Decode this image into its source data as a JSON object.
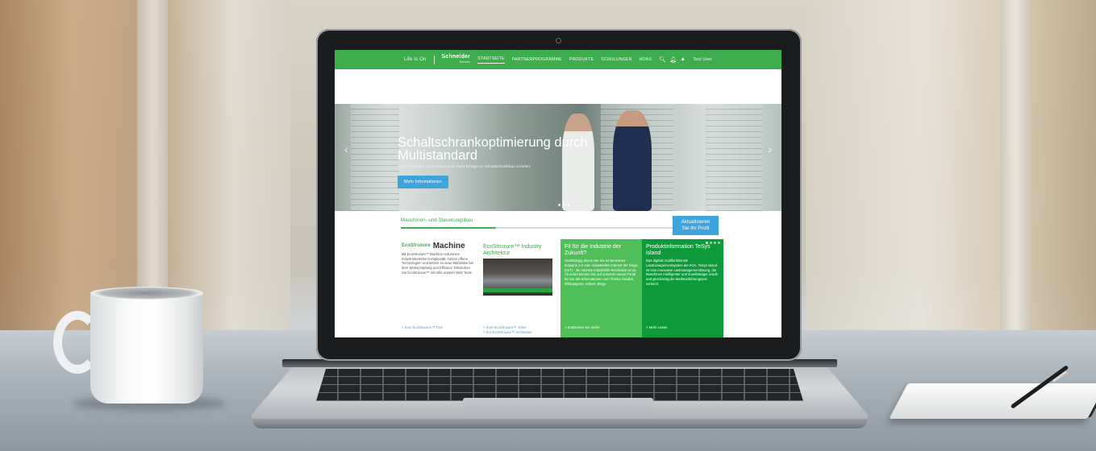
{
  "topbar": {
    "brand": "Life Is On",
    "logo_main": "Schneider",
    "logo_sub": "Electric",
    "nav": [
      "STARTSEITE",
      "PARTNERPROGRAMME",
      "PRODUKTE",
      "SCHULUNGEN",
      "HOAS"
    ],
    "active_nav_index": 0,
    "icons": [
      "search-icon",
      "bell-icon",
      "user-icon"
    ],
    "user": "Test User"
  },
  "hero": {
    "title": "Schaltschrankoptimierung durch Multistandard",
    "subtitle": "Durch Produkte mit Multistandard mehr Erfolge im Schaltschrankbau erzielen.",
    "button": "Mehr Informationen",
    "prev": "‹",
    "next": "›"
  },
  "section": {
    "tab": "Maschinen- und Steuerungsbau",
    "profile_button_line1": "Aktualisieren",
    "profile_button_line2": "Sie Ihr Profil"
  },
  "cards": [
    {
      "logo": "EcoStruxure",
      "title": "Machine",
      "body": "Mit EcoStruxure™ Machine reduzieren Industriebetriebe Komplexität, nutzen offene Technologien und setzen so neue Maßstäbe bei ihrer Wertschöpfung und Effizienz. Entdecken Sie EcoStruxure™ mit Hilfe unserer Web Tools.",
      "link": "> Zum EcoStruxure™ Tool"
    },
    {
      "title": "EcoStruxure™ Industry Architektur",
      "link1": "> Zum EcoStruxure™ Video",
      "link2": "> Zur EcoStruxure™ Architektur"
    },
    {
      "title": "Fit für die Industrie der Zukunft?",
      "body": "Unabhängig davon wie Sie es benennen - Industrie 4.0 oder Industrielles Internet der Dinge (IIoT) - die nächste industrielle Revolution ist da. Ab sofort können Sie auf unserem neuen Portal für Sie alle Informationen zum Thema Studien, Whitepapers, Videos, Blogs.",
      "link": "> Entdecken Sie mehr!"
    },
    {
      "title": "Produktinformation TeSys island",
      "body": "Das digitale multifunktionale Lastmanagementsystem der IIOA. TeSys island ist eine innovative Lastmanagementlösung, die Maschinen intelligenter und zuverlässiger macht und gleichzeitig die Markteinführungszeit verkürzt.",
      "link": "> Mehr Lesen"
    }
  ],
  "colors": {
    "brand_green": "#3dad4e",
    "dark_green": "#0e9a3a",
    "light_green": "#4fbf5a",
    "accent_blue": "#3ea4db"
  }
}
